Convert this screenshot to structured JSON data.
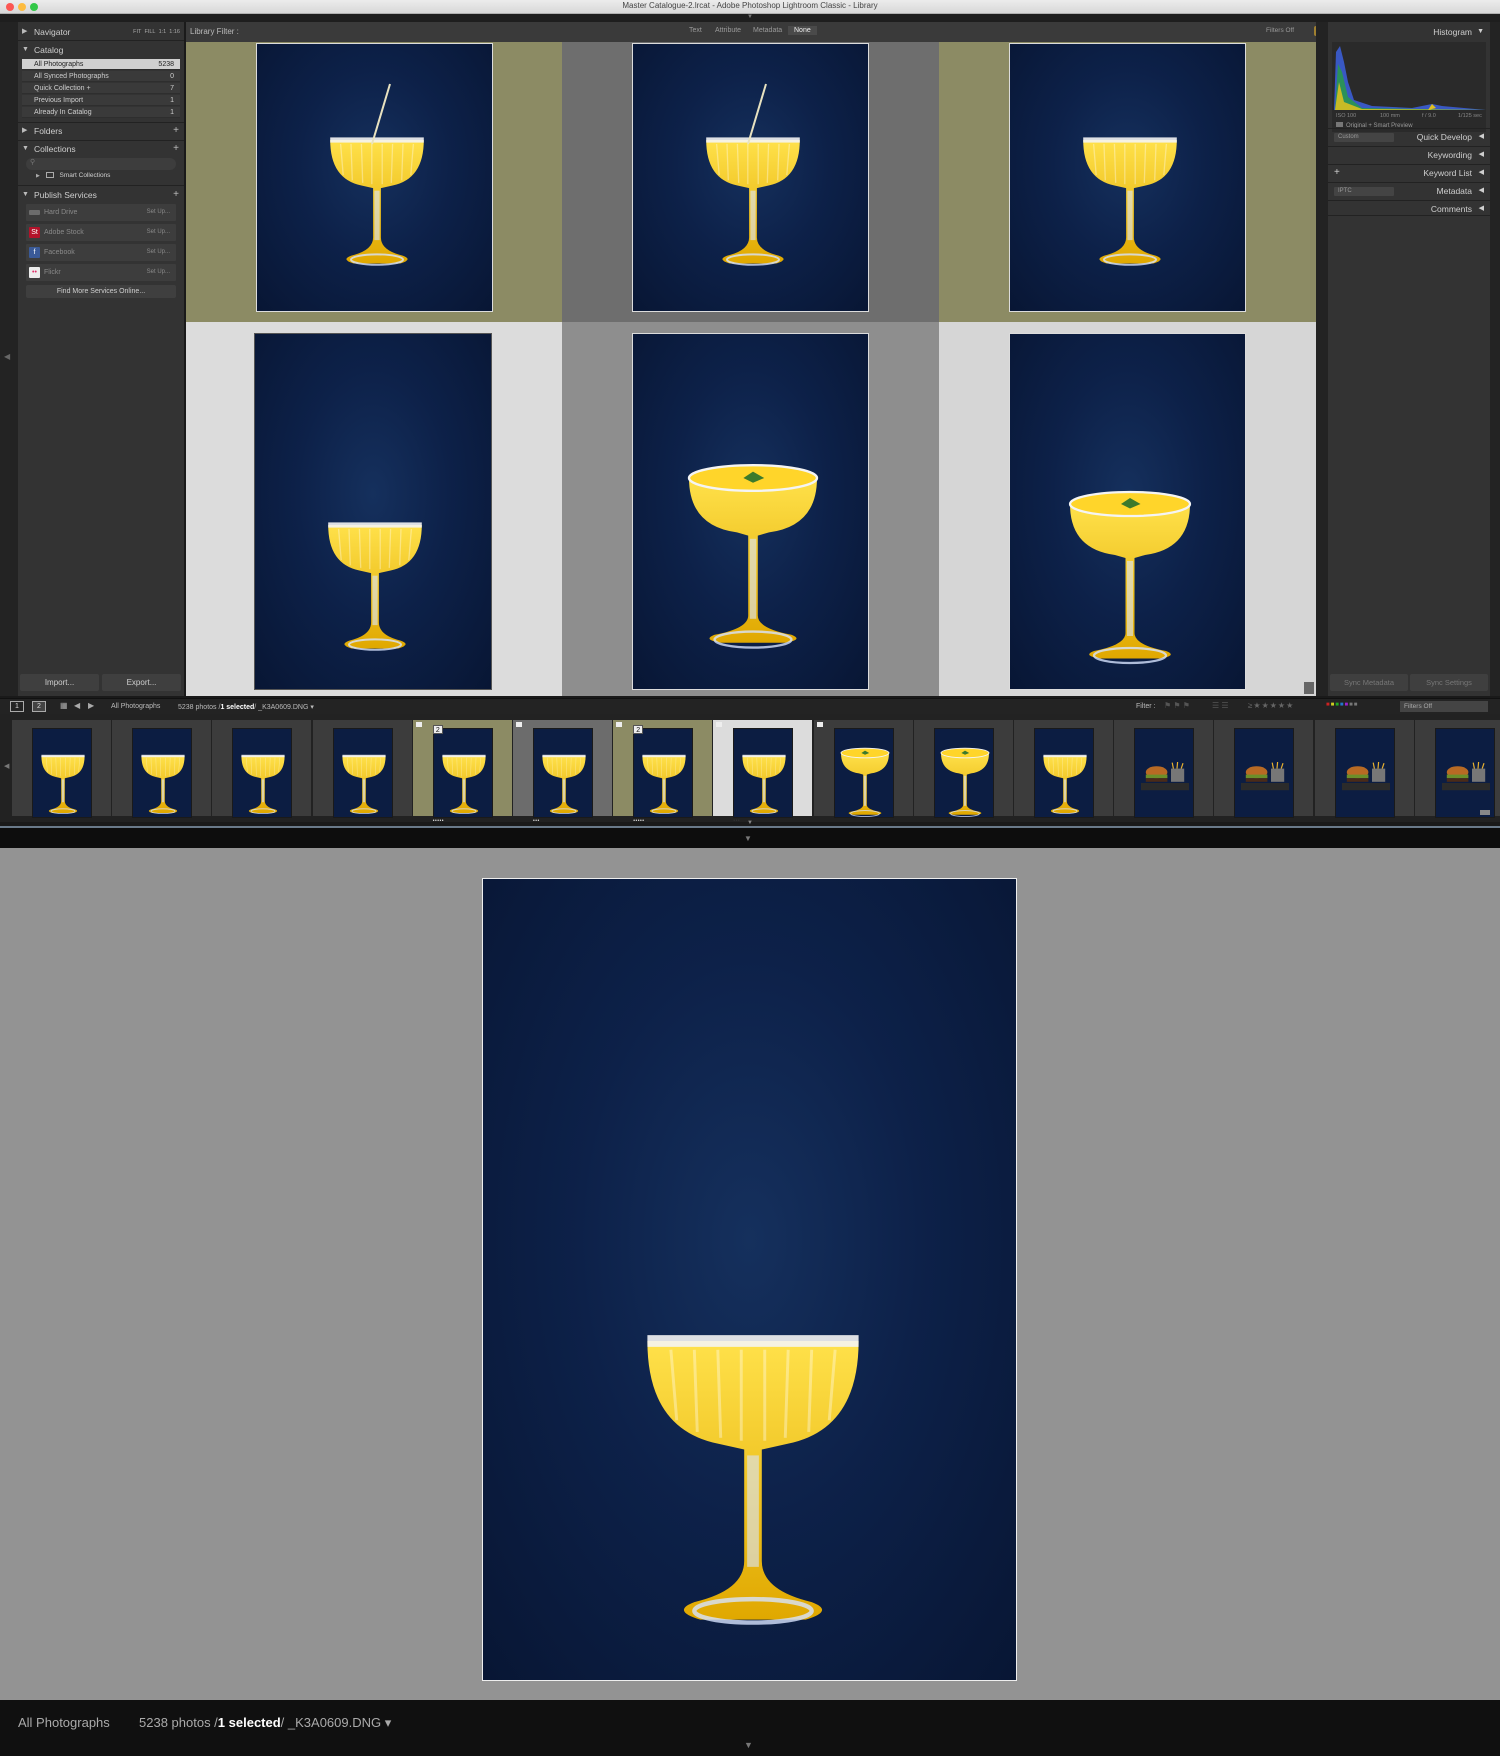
{
  "window": {
    "title": "Master Catalogue-2.lrcat - Adobe Photoshop Lightroom Classic - Library"
  },
  "navigator": {
    "title": "Navigator",
    "zoom_options": [
      "FIT",
      "FILL",
      "1:1",
      "1:16"
    ]
  },
  "catalog": {
    "title": "Catalog",
    "items": [
      {
        "label": "All Photographs",
        "count": "5238"
      },
      {
        "label": "All Synced Photographs",
        "count": "0"
      },
      {
        "label": "Quick Collection +",
        "count": "7"
      },
      {
        "label": "Previous Import",
        "count": "1"
      },
      {
        "label": "Already In Catalog",
        "count": "1"
      }
    ]
  },
  "folders": {
    "title": "Folders"
  },
  "collections": {
    "title": "Collections",
    "items": [
      {
        "label": "Smart Collections"
      }
    ]
  },
  "publish_services": {
    "title": "Publish Services",
    "items": [
      {
        "label": "Hard Drive",
        "action": "Set Up...",
        "color": "#6c6c6c",
        "icon": ""
      },
      {
        "label": "Adobe Stock",
        "action": "Set Up...",
        "color": "#b3122a",
        "icon": "St"
      },
      {
        "label": "Facebook",
        "action": "Set Up...",
        "color": "#3a5a98",
        "icon": "f"
      },
      {
        "label": "Flickr",
        "action": "Set Up...",
        "color": "#ececec",
        "icon": "••"
      }
    ],
    "find_more": "Find More Services Online..."
  },
  "left_buttons": {
    "import": "Import...",
    "export": "Export..."
  },
  "library_filter": {
    "label": "Library Filter :",
    "tabs": [
      "Text",
      "Attribute",
      "Metadata",
      "None"
    ],
    "active": "None",
    "status": "Filters Off"
  },
  "histogram": {
    "title": "Histogram",
    "iso": "ISO 100",
    "focal": "100 mm",
    "aperture": "f / 9.0",
    "shutter": "1/125 sec",
    "preview_info": "Original + Smart Preview"
  },
  "right_panels": {
    "preset": "Custom",
    "items": [
      "Quick Develop",
      "Keywording",
      "Keyword List",
      "Metadata",
      "Comments"
    ],
    "metadata_preset": "IPTC",
    "sync_metadata": "Sync Metadata",
    "sync_settings": "Sync Settings"
  },
  "toolbar": {
    "source": "All Photographs",
    "photo_count": "5238 photos /",
    "selected": "1 selected",
    "filename": "/ _K3A0609.DNG",
    "filter_label": "Filter :",
    "filter_status": "Filters Off",
    "screen1": "1",
    "screen2": "2"
  },
  "filmstrip": {
    "badges": [
      "2",
      "2"
    ]
  },
  "secondary_window": {
    "source": "All Photographs",
    "photo_count": "5238 photos /",
    "selected": "1 selected",
    "filename": "/ _K3A0609.DNG"
  },
  "colors": {
    "panel": "#333333",
    "photo_bg": "#0c1d42",
    "drink": "#f2c414",
    "cell_olive": "#8c8b64",
    "cell_selected": "#dcdcdc"
  }
}
